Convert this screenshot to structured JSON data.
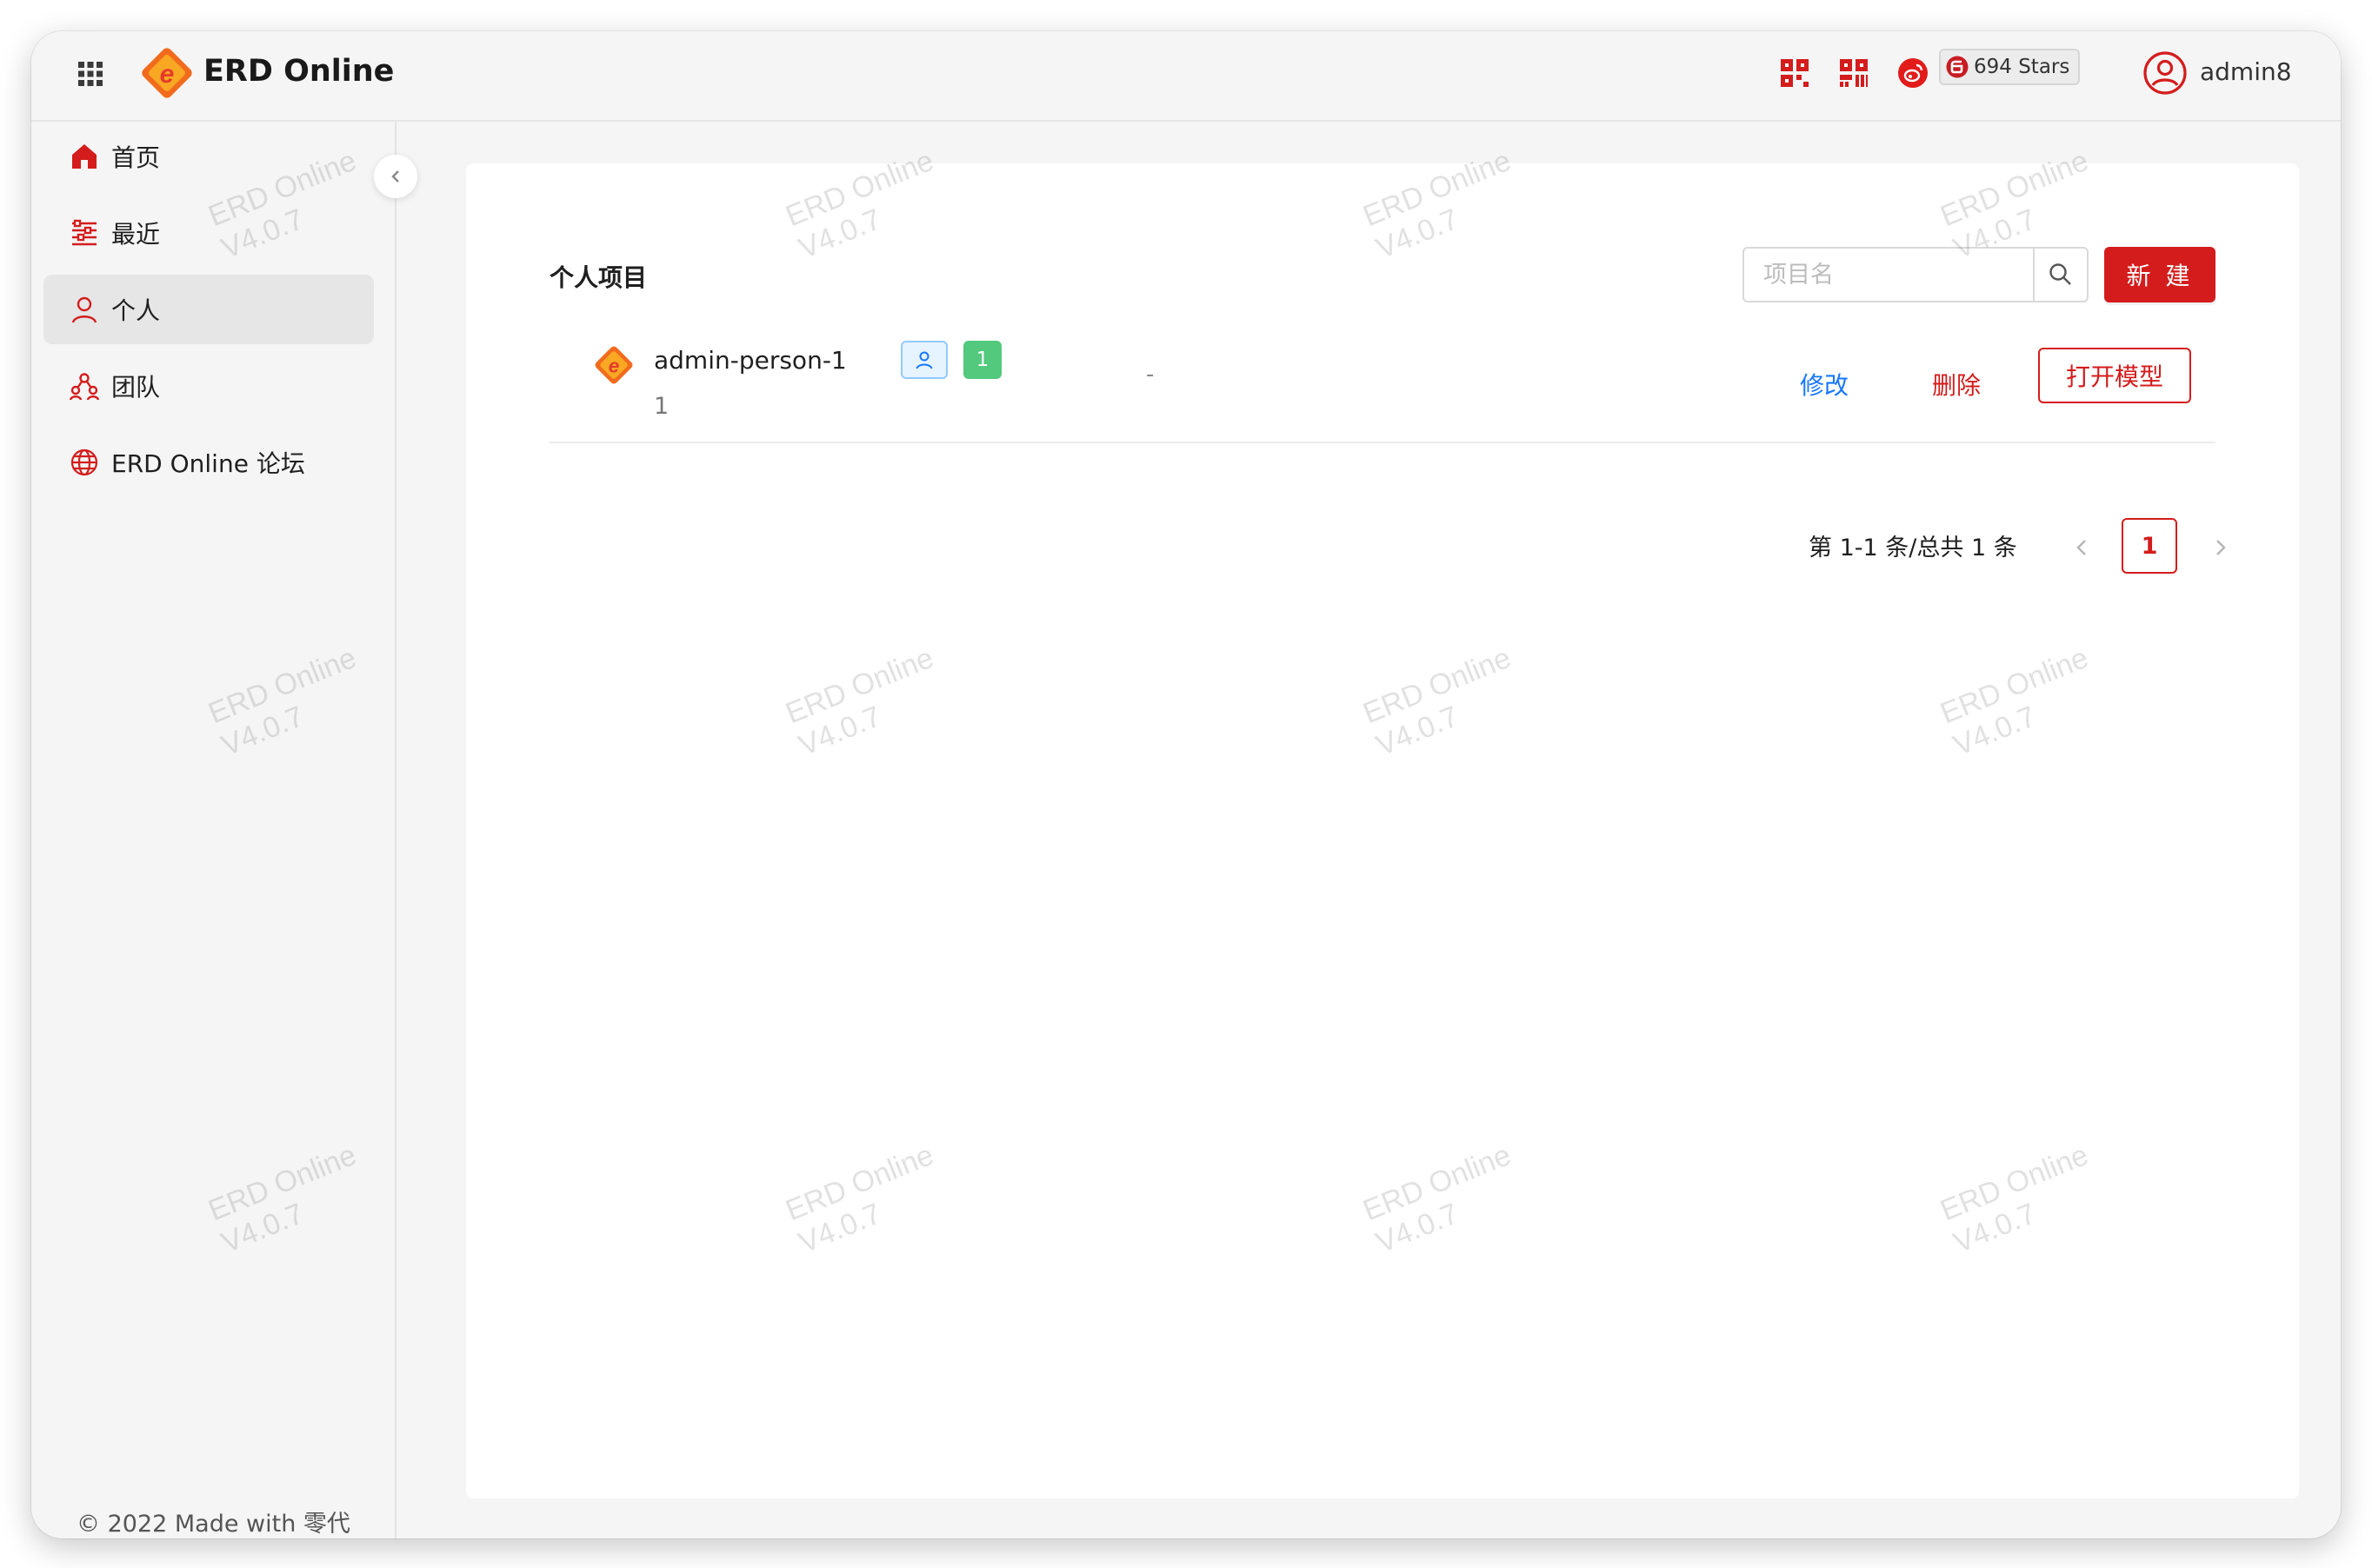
{
  "app": {
    "title": "ERD Online"
  },
  "header": {
    "stars_label": "694 Stars",
    "username": "admin8",
    "icons": [
      "grid-apps-icon",
      "qr-code-icon",
      "qr-code-alt-icon",
      "weibo-icon",
      "gitee-icon",
      "user-avatar-icon"
    ]
  },
  "sidebar": {
    "items": [
      {
        "label": "首页",
        "icon": "home-icon"
      },
      {
        "label": "最近",
        "icon": "recent-icon"
      },
      {
        "label": "个人",
        "icon": "user-icon",
        "active": true
      },
      {
        "label": "团队",
        "icon": "team-icon"
      },
      {
        "label": "ERD Online 论坛",
        "icon": "globe-icon"
      }
    ],
    "footer": "© 2022 Made with 零代"
  },
  "main": {
    "page_title": "个人项目",
    "search_placeholder": "项目名",
    "new_button": "新 建",
    "projects": [
      {
        "name": "admin-person-1",
        "description": "1",
        "type_tag_icon": "user-icon",
        "count_tag": "1",
        "extra": "-",
        "edit_label": "修改",
        "delete_label": "删除",
        "open_label": "打开模型"
      }
    ],
    "pagination": {
      "total_text": "第 1-1 条/总共 1 条",
      "current_page": "1"
    }
  },
  "watermark": {
    "line1": "ERD Online",
    "line2": "V4.0.7"
  },
  "colors": {
    "brand_red": "#d41c1c",
    "link_blue": "#1677ff",
    "tag_green": "#52c97d",
    "tag_blue_border": "#91caff"
  }
}
